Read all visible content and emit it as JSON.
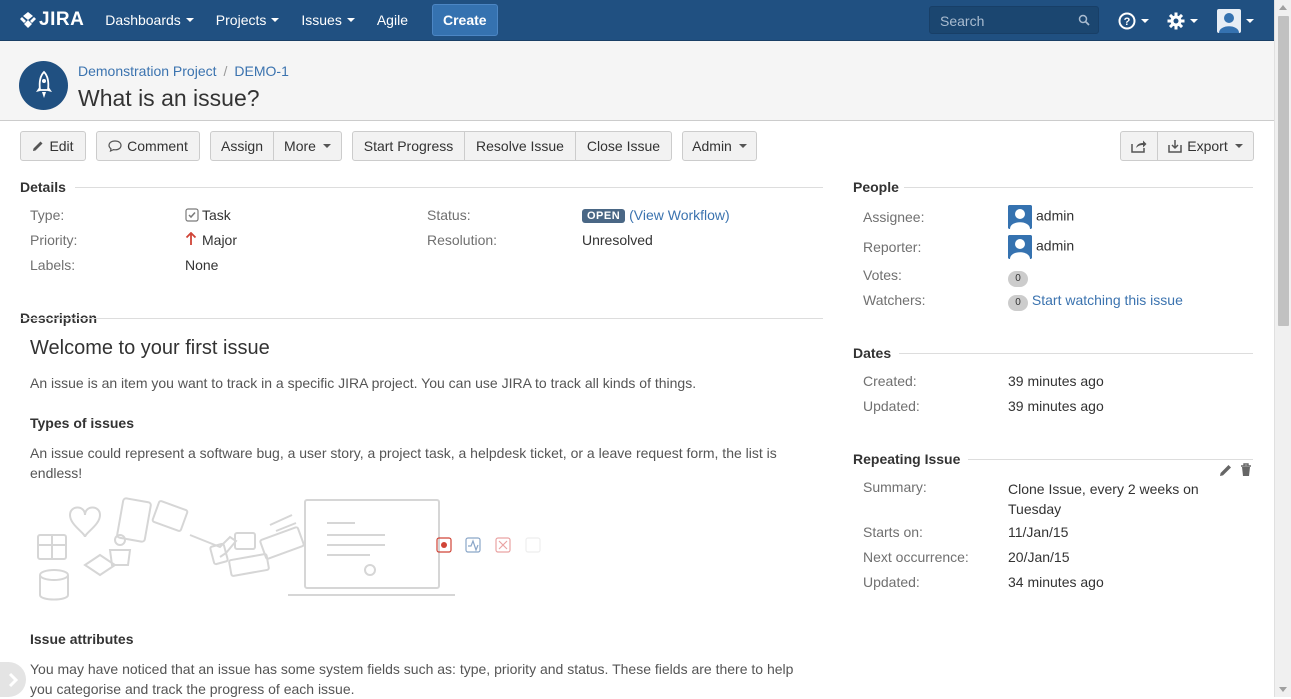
{
  "nav": {
    "logo": "JIRA",
    "items": [
      {
        "label": "Dashboards"
      },
      {
        "label": "Projects"
      },
      {
        "label": "Issues"
      },
      {
        "label": "Agile"
      }
    ],
    "create_label": "Create",
    "search_placeholder": "Search"
  },
  "breadcrumb": {
    "project": "Demonstration Project",
    "separator": "/",
    "issue_key": "DEMO-1"
  },
  "issue": {
    "summary": "What is an issue?"
  },
  "toolbar": {
    "edit": "Edit",
    "comment": "Comment",
    "assign": "Assign",
    "more": "More",
    "start_progress": "Start Progress",
    "resolve_issue": "Resolve Issue",
    "close_issue": "Close Issue",
    "admin": "Admin",
    "export": "Export"
  },
  "details": {
    "heading": "Details",
    "type_label": "Type:",
    "type_value": "Task",
    "priority_label": "Priority:",
    "priority_value": "Major",
    "labels_label": "Labels:",
    "labels_value": "None",
    "status_label": "Status:",
    "status_value": "OPEN",
    "view_workflow": "View Workflow",
    "paren_open": "(",
    "paren_close": ")",
    "resolution_label": "Resolution:",
    "resolution_value": "Unresolved"
  },
  "description": {
    "heading": "Description",
    "title": "Welcome to your first issue",
    "intro": "An issue is an item you want to track in a specific JIRA project. You can use JIRA to track all kinds of things.",
    "types_heading": "Types of issues",
    "types_text": "An issue could represent a software bug, a user story, a project task, a helpdesk ticket, or a leave request form, the list is endless!",
    "attributes_heading": "Issue attributes",
    "attributes_text": "You may have noticed that an issue has some system fields such as: type, priority and status. These fields are there to help you categorise and track the progress of each issue."
  },
  "people": {
    "heading": "People",
    "assignee_label": "Assignee:",
    "assignee_value": "admin",
    "reporter_label": "Reporter:",
    "reporter_value": "admin",
    "votes_label": "Votes:",
    "votes_count": "0",
    "watchers_label": "Watchers:",
    "watchers_count": "0",
    "watch_link": "Start watching this issue"
  },
  "dates": {
    "heading": "Dates",
    "created_label": "Created:",
    "created_value": "39 minutes ago",
    "updated_label": "Updated:",
    "updated_value": "39 minutes ago"
  },
  "repeating": {
    "heading": "Repeating Issue",
    "summary_label": "Summary:",
    "summary_value_line1": "Clone Issue, every 2 weeks on",
    "summary_value_line2": "Tuesday",
    "starts_label": "Starts on:",
    "starts_value": "11/Jan/15",
    "next_label": "Next occurrence:",
    "next_value": "20/Jan/15",
    "updated_label": "Updated:",
    "updated_value": "34 minutes ago"
  },
  "colors": {
    "header_bg": "#205081",
    "link": "#3b73af",
    "status_lozenge": "#4a6785",
    "priority_major": "#d04437"
  }
}
